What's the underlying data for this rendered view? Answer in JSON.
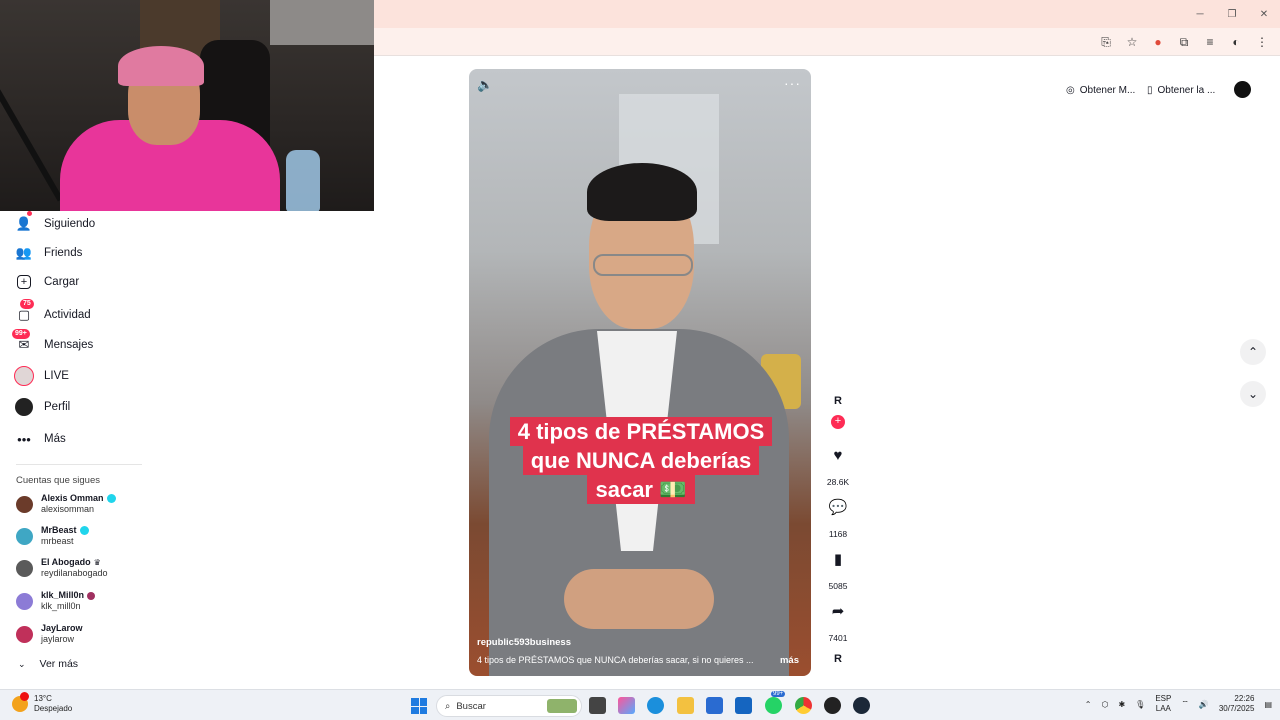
{
  "sidebar": {
    "items": [
      {
        "label": "Siguiendo",
        "icon": "following-icon"
      },
      {
        "label": "Friends",
        "icon": "friends-icon"
      },
      {
        "label": "Cargar",
        "icon": "upload-icon"
      },
      {
        "label": "Actividad",
        "icon": "activity-icon",
        "badge": "75"
      },
      {
        "label": "Mensajes",
        "icon": "messages-icon",
        "badge": "99+"
      },
      {
        "label": "LIVE",
        "icon": "live-icon"
      },
      {
        "label": "Perfil",
        "icon": "profile-icon"
      },
      {
        "label": "Más",
        "icon": "more-icon"
      }
    ],
    "following_title": "Cuentas que sigues",
    "accounts": [
      {
        "name": "Alexis Omman",
        "handle": "alexisomman",
        "verified": true,
        "color": "#6b3b2a"
      },
      {
        "name": "MrBeast",
        "handle": "mrbeast",
        "verified": true,
        "color": "#3fa7c4"
      },
      {
        "name": "El Abogado",
        "handle": "reydilanabogado",
        "verified": false,
        "color": "#5a5a5a"
      },
      {
        "name": "klk_Mill0n",
        "handle": "klk_mill0n",
        "verified": false,
        "color": "#8c7bd6"
      },
      {
        "name": "JayLarow",
        "handle": "jaylarow",
        "verified": false,
        "color": "#c0305a"
      }
    ],
    "see_more": "Ver más"
  },
  "header": {
    "pill1": "Obtener M...",
    "pill2": "Obtener la ..."
  },
  "video": {
    "caption": "4 tipos de PRÉSTAMOS que NUNCA deberías sacar 💵",
    "author": "republic593business",
    "description": "4 tipos de PRÉSTAMOS que NUNCA deberías sacar, si no quieres ...",
    "more": "más"
  },
  "actions": {
    "likes": "28.6K",
    "comments": "1168",
    "saves": "5085",
    "shares": "7401"
  },
  "taskbar": {
    "temperature": "13°C",
    "weather": "Despejado",
    "search_placeholder": "Buscar",
    "lang1": "ESP",
    "lang2": "LAA",
    "time": "22:26",
    "date": "30/7/2025",
    "notif_badge": "99+"
  },
  "colors": {
    "accent": "#fe2c55",
    "caption_bg": "#e0334d",
    "titlebar": "#fce3dc"
  }
}
